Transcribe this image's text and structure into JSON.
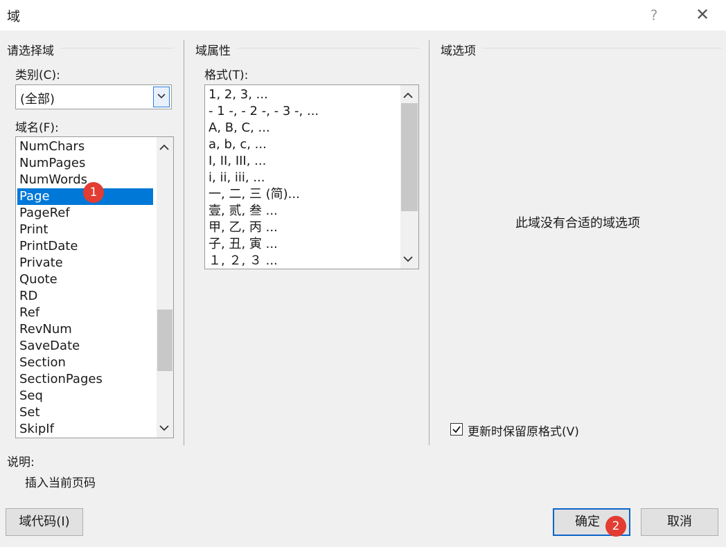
{
  "window": {
    "title": "域",
    "help_glyph": "?",
    "close_glyph": "✕"
  },
  "left": {
    "section_title": "请选择域",
    "category": {
      "label": "类别(C):",
      "label_key": "C",
      "value": "(全部)"
    },
    "fieldnames": {
      "label": "域名(F):",
      "label_key": "F",
      "items": [
        "NumChars",
        "NumPages",
        "NumWords",
        "Page",
        "PageRef",
        "Print",
        "PrintDate",
        "Private",
        "Quote",
        "RD",
        "Ref",
        "RevNum",
        "SaveDate",
        "Section",
        "SectionPages",
        "Seq",
        "Set",
        "SkipIf"
      ],
      "selected": "Page"
    }
  },
  "middle": {
    "section_title": "域属性",
    "format": {
      "label": "格式(T):",
      "label_key": "T",
      "items": [
        "1, 2, 3, ...",
        "- 1 -, - 2 -, - 3 -, ...",
        "A, B, C, ...",
        "a, b, c, ...",
        "I, II, III, ...",
        "i, ii, iii, ...",
        "一, 二, 三 (简)...",
        "壹, 贰, 叁 ...",
        "甲, 乙, 丙 ...",
        "子, 丑, 寅 ...",
        "１, ２, ３ ..."
      ]
    }
  },
  "right": {
    "section_title": "域选项",
    "no_options_text": "此域没有合适的域选项",
    "keep_format": {
      "label": "更新时保留原格式(V)",
      "checked": true
    }
  },
  "description": {
    "label": "说明:",
    "text": "插入当前页码"
  },
  "buttons": {
    "field_codes": "域代码(I)",
    "ok": "确定",
    "cancel": "取消"
  },
  "annotations": {
    "badge1": "1",
    "badge2": "2"
  },
  "colors": {
    "selection": "#0078d7",
    "badge": "#e23c33",
    "default_button_border": "#0a64c8"
  }
}
